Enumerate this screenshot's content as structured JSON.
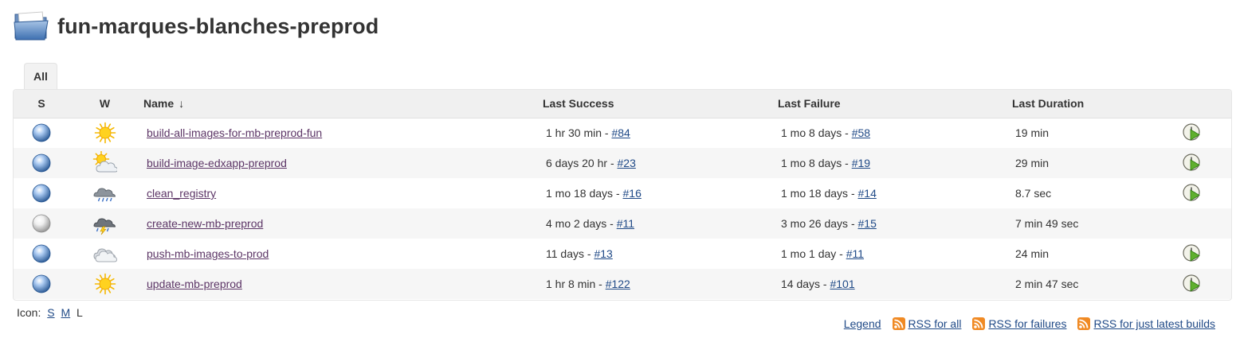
{
  "page": {
    "title": "fun-marques-blanches-preprod",
    "folder_icon": "folder-icon"
  },
  "tabs": [
    {
      "label": "All",
      "active": true
    }
  ],
  "table": {
    "headers": {
      "s": "S",
      "w": "W",
      "name": "Name",
      "name_sort": "↓",
      "last_success": "Last Success",
      "last_failure": "Last Failure",
      "last_duration": "Last Duration"
    },
    "rows": [
      {
        "status": "blue",
        "weather": "sunny",
        "name": "build-all-images-for-mb-preprod-fun",
        "success_text": "1 hr 30 min - ",
        "success_build": "#84",
        "failure_text": "1 mo 8 days - ",
        "failure_build": "#58",
        "duration": "19 min",
        "schedule": true
      },
      {
        "status": "blue",
        "weather": "partly-cloudy",
        "name": "build-image-edxapp-preprod",
        "success_text": "6 days 20 hr - ",
        "success_build": "#23",
        "failure_text": "1 mo 8 days - ",
        "failure_build": "#19",
        "duration": "29 min",
        "schedule": true
      },
      {
        "status": "blue",
        "weather": "rain",
        "name": "clean_registry",
        "success_text": "1 mo 18 days - ",
        "success_build": "#16",
        "failure_text": "1 mo 18 days - ",
        "failure_build": "#14",
        "duration": "8.7 sec",
        "schedule": true
      },
      {
        "status": "grey",
        "weather": "thunderstorm",
        "name": "create-new-mb-preprod",
        "success_text": "4 mo 2 days - ",
        "success_build": "#11",
        "failure_text": "3 mo 26 days - ",
        "failure_build": "#15",
        "duration": "7 min 49 sec",
        "schedule": false
      },
      {
        "status": "blue",
        "weather": "cloudy",
        "name": "push-mb-images-to-prod",
        "success_text": "11 days - ",
        "success_build": "#13",
        "failure_text": "1 mo 1 day - ",
        "failure_build": "#11",
        "duration": "24 min",
        "schedule": true
      },
      {
        "status": "blue",
        "weather": "sunny",
        "name": "update-mb-preprod",
        "success_text": "1 hr 8 min - ",
        "success_build": "#122",
        "failure_text": "14 days - ",
        "failure_build": "#101",
        "duration": "2 min 47 sec",
        "schedule": true
      }
    ]
  },
  "icon_size": {
    "label": "Icon:",
    "options": [
      {
        "label": "S",
        "link": true
      },
      {
        "label": "M",
        "link": true
      },
      {
        "label": "L",
        "link": false
      }
    ]
  },
  "footer": {
    "legend": "Legend",
    "rss_all": "RSS for all",
    "rss_failures": "RSS for failures",
    "rss_latest": "RSS for just latest builds"
  },
  "colors": {
    "link_job": "#5c3566",
    "link_build": "#204a87",
    "status_blue": "#3465a4",
    "status_grey": "#a0a0a0",
    "rss_orange": "#f08a24"
  }
}
